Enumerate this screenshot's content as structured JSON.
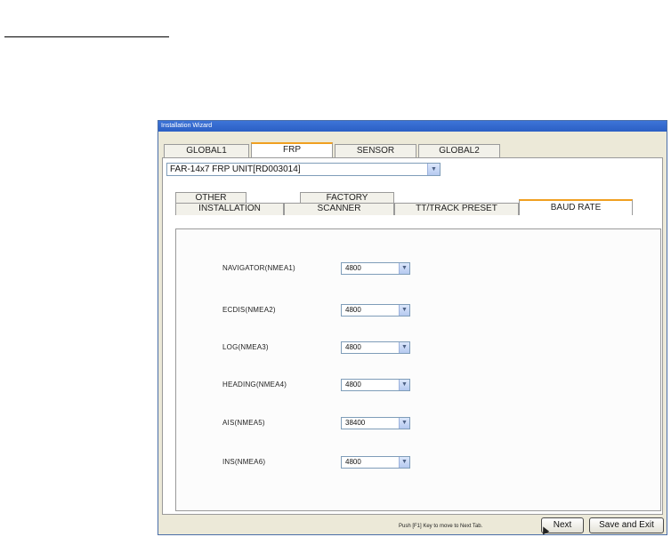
{
  "window": {
    "title": "Installation Wizard"
  },
  "top_tabs": [
    {
      "label": "GLOBAL1"
    },
    {
      "label": "FRP"
    },
    {
      "label": "SENSOR"
    },
    {
      "label": "GLOBAL2"
    }
  ],
  "active_top_tab": "FRP",
  "unit_selector": {
    "value": "FAR-14x7 FRP UNIT[RD003014]"
  },
  "sub_tabs_back_row": [
    {
      "label": "OTHER"
    },
    {
      "label": "FACTORY"
    }
  ],
  "sub_tabs_front_row": [
    {
      "label": "INSTALLATION"
    },
    {
      "label": "SCANNER"
    },
    {
      "label": "TT/TRACK PRESET"
    },
    {
      "label": "BAUD RATE"
    }
  ],
  "active_sub_tab": "BAUD RATE",
  "baud_rates": [
    {
      "label": "NAVIGATOR(NMEA1)",
      "value": "4800"
    },
    {
      "label": "ECDIS(NMEA2)",
      "value": "4800"
    },
    {
      "label": "LOG(NMEA3)",
      "value": "4800"
    },
    {
      "label": "HEADING(NMEA4)",
      "value": "4800"
    },
    {
      "label": "AIS(NMEA5)",
      "value": "38400"
    },
    {
      "label": "INS(NMEA6)",
      "value": "4800"
    }
  ],
  "footer": {
    "hint": "Push [F1] Key to move to Next Tab.",
    "next_label": "Next",
    "save_exit_label": "Save and Exit"
  }
}
